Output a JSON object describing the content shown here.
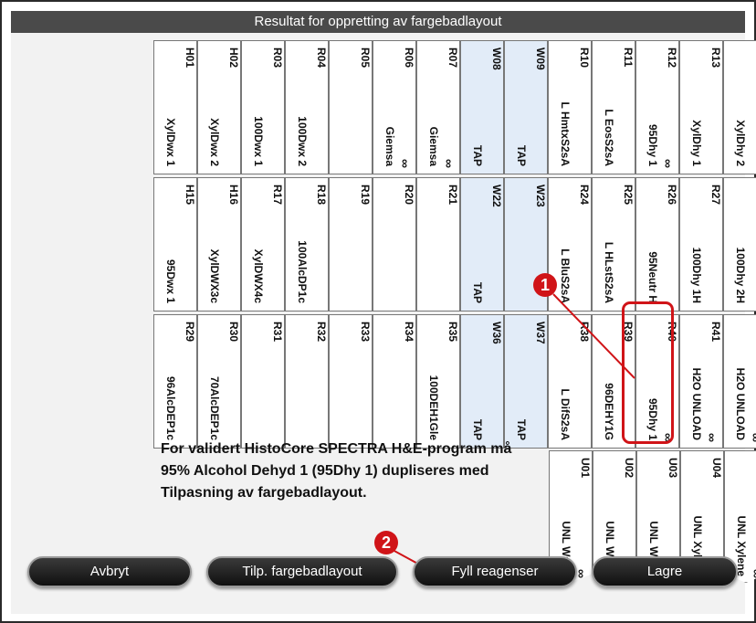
{
  "window": {
    "title": "Resultat for oppretting av fargebadlayout"
  },
  "row1": [
    {
      "id": "H01",
      "name": "XylDwx 1",
      "inf": "",
      "water": false
    },
    {
      "id": "H02",
      "name": "XylDwx 2",
      "inf": "",
      "water": false
    },
    {
      "id": "R03",
      "name": "100Dwx 1",
      "inf": "",
      "water": false
    },
    {
      "id": "R04",
      "name": "100Dwx 2",
      "inf": "",
      "water": false
    },
    {
      "id": "R05",
      "name": "",
      "inf": "",
      "water": false
    },
    {
      "id": "R06",
      "name": "Giemsa",
      "inf": "∞",
      "water": false
    },
    {
      "id": "R07",
      "name": "Giemsa",
      "inf": "∞",
      "water": false
    },
    {
      "id": "W08",
      "name": "TAP",
      "inf": "",
      "water": true
    },
    {
      "id": "W09",
      "name": "TAP",
      "inf": "",
      "water": true
    },
    {
      "id": "R10",
      "name": "L HmtxS2sA",
      "inf": "",
      "water": false
    },
    {
      "id": "R11",
      "name": "L EosS2sA",
      "inf": "",
      "water": false
    },
    {
      "id": "R12",
      "name": "95Dhy 1",
      "inf": "∞",
      "water": false
    },
    {
      "id": "R13",
      "name": "XylDhy 1",
      "inf": "",
      "water": false
    },
    {
      "id": "R14",
      "name": "XylDhy 2",
      "inf": "",
      "water": false
    }
  ],
  "row2": [
    {
      "id": "H15",
      "name": "95Dwx 1",
      "inf": "",
      "water": false
    },
    {
      "id": "H16",
      "name": "XylDWX3c",
      "inf": "",
      "water": false
    },
    {
      "id": "R17",
      "name": "XylDWX4c",
      "inf": "",
      "water": false
    },
    {
      "id": "R18",
      "name": "100AlcDP1c",
      "inf": "",
      "water": false
    },
    {
      "id": "R19",
      "name": "",
      "inf": "",
      "water": false
    },
    {
      "id": "R20",
      "name": "",
      "inf": "",
      "water": false
    },
    {
      "id": "R21",
      "name": "",
      "inf": "",
      "water": false
    },
    {
      "id": "W22",
      "name": "TAP",
      "inf": "",
      "water": true
    },
    {
      "id": "W23",
      "name": "",
      "inf": "",
      "water": true
    },
    {
      "id": "R24",
      "name": "L BluS2sA",
      "inf": "",
      "water": false
    },
    {
      "id": "R25",
      "name": "L HLstS2sA",
      "inf": "",
      "water": false
    },
    {
      "id": "R26",
      "name": "95Neutr H",
      "inf": "",
      "water": false
    },
    {
      "id": "R27",
      "name": "100Dhy 1H",
      "inf": "",
      "water": false
    },
    {
      "id": "R28",
      "name": "100Dhy 2H",
      "inf": "",
      "water": false
    }
  ],
  "row3": [
    {
      "id": "R29",
      "name": "96AlcDEP1c",
      "inf": "",
      "water": false
    },
    {
      "id": "R30",
      "name": "70AlcDEP1c",
      "inf": "",
      "water": false
    },
    {
      "id": "R31",
      "name": "",
      "inf": "",
      "water": false
    },
    {
      "id": "R32",
      "name": "",
      "inf": "",
      "water": false
    },
    {
      "id": "R33",
      "name": "",
      "inf": "",
      "water": false
    },
    {
      "id": "R34",
      "name": "",
      "inf": "",
      "water": false
    },
    {
      "id": "R35",
      "name": "100DEH1Gle",
      "inf": "",
      "water": false
    },
    {
      "id": "W36",
      "name": "TAP",
      "inf": "",
      "water": true
    },
    {
      "id": "W37",
      "name": "TAP",
      "inf": "",
      "water": true
    },
    {
      "id": "R38",
      "name": "L DifS2sA",
      "inf": "",
      "water": false
    },
    {
      "id": "R39",
      "name": "96DEHY1G",
      "inf": "",
      "water": false
    },
    {
      "id": "R40",
      "name": "95Dhy 1",
      "inf": "∞",
      "water": false
    },
    {
      "id": "R41",
      "name": "H2O UNLOAD",
      "inf": "∞",
      "water": false
    },
    {
      "id": "R42",
      "name": "H2O UNLOAD",
      "inf": "∞",
      "water": false
    }
  ],
  "unload": [
    {
      "id": "U01",
      "name": "UNL Water",
      "inf": "∞",
      "water": false
    },
    {
      "id": "U02",
      "name": "UNL Water",
      "inf": "∞",
      "water": false
    },
    {
      "id": "U03",
      "name": "UNL Water",
      "inf": "∞",
      "water": false
    },
    {
      "id": "U04",
      "name": "UNL Xylene",
      "inf": "∞",
      "water": false
    },
    {
      "id": "U05",
      "name": "UNL Xylene",
      "inf": "∞",
      "water": false
    }
  ],
  "note": "For validert HistoCore SPECTRA H&E-program må 95% Alcohol Dehyd 1 (95Dhy 1) dupliseres med Tilpasning av fargebadlayout.",
  "callouts": {
    "c1": "1",
    "c2": "2"
  },
  "buttons": {
    "cancel": "Avbryt",
    "adjust": "Tilp. fargebadlayout",
    "fill": "Fyll reagenser",
    "save": "Lagre"
  },
  "colors": {
    "callout": "#d01418",
    "water_station": "#e2ecf8",
    "title_bar": "#4a4a4a"
  }
}
